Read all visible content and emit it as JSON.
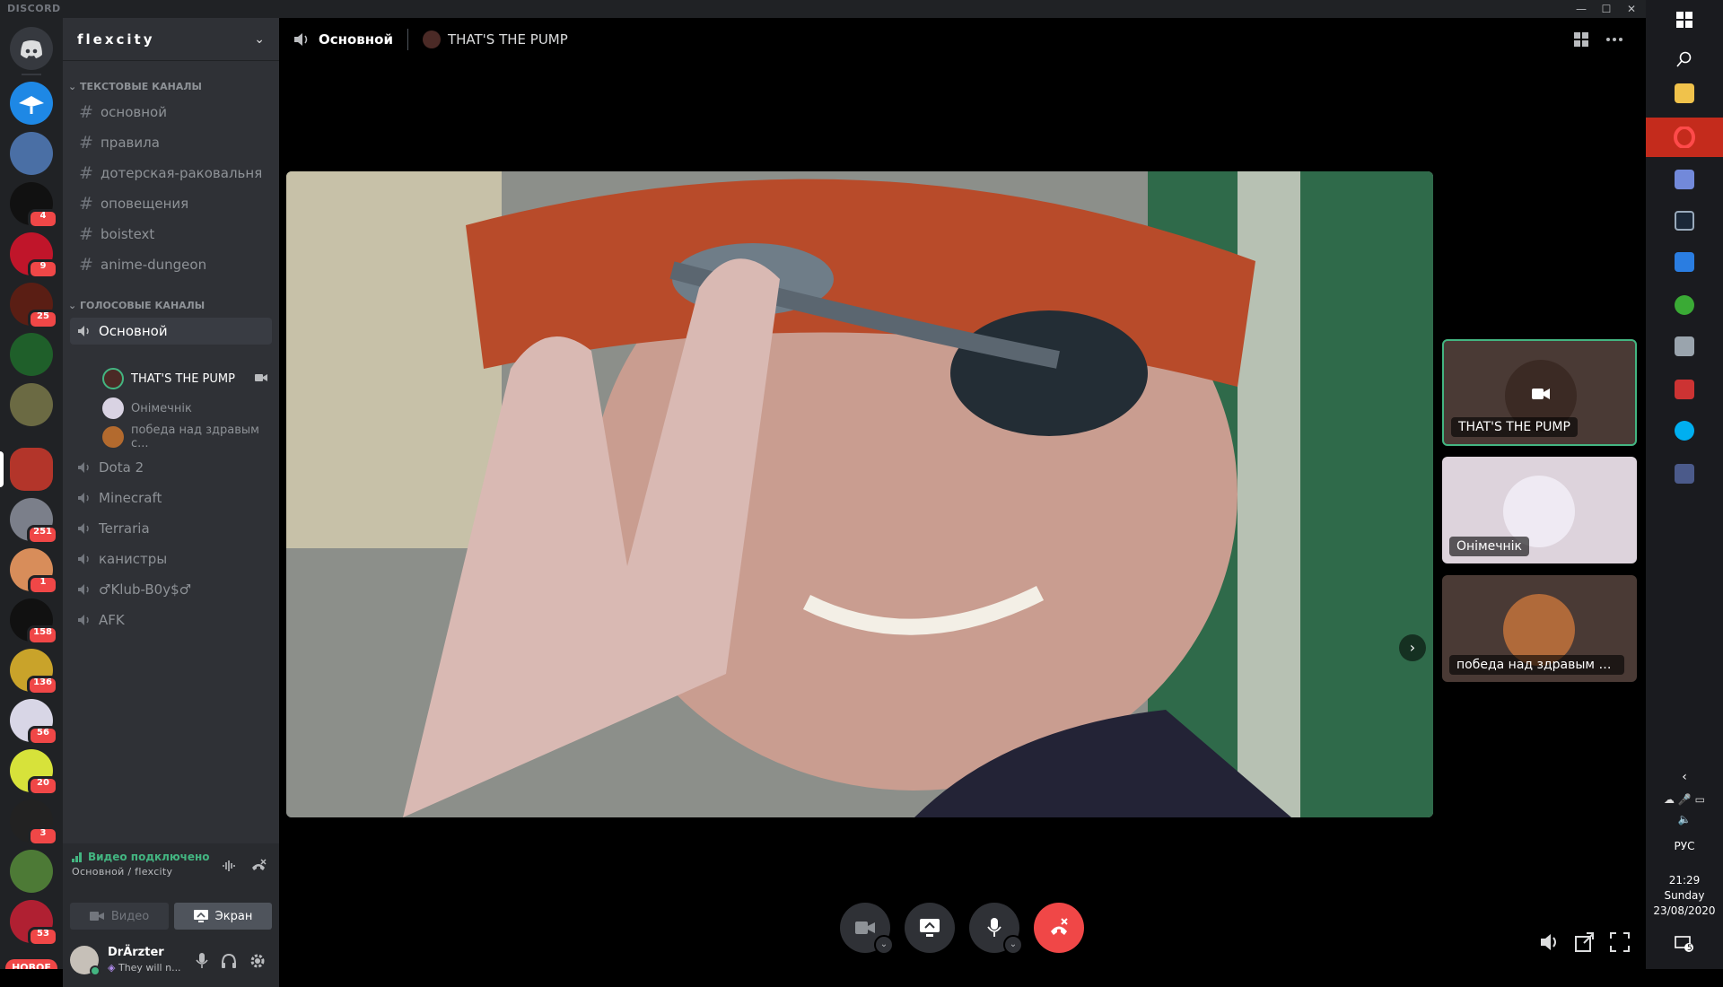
{
  "window": {
    "brand": "DISCORD",
    "minimize_glyph": "—",
    "maximize_glyph": "☐",
    "close_glyph": "✕"
  },
  "servers": {
    "new_label": "НОВОЕ",
    "badges": [
      "4",
      "9",
      "25",
      "251",
      "1",
      "158",
      "136",
      "56",
      "20",
      "3",
      "53"
    ]
  },
  "guild": {
    "name": "flexcity"
  },
  "text_category": "ТЕКСТОВЫЕ КАНАЛЫ",
  "text_channels": [
    "основной",
    "правила",
    "дотерская-раковальня",
    "оповещения",
    "boistext",
    "anime-dungeon"
  ],
  "voice_category": "ГОЛОСОВЫЕ КАНАЛЫ",
  "voice_channels": {
    "active": "Основной",
    "members": [
      "THAT'S THE PUMP",
      "Онімечнік",
      "победа над здравым с..."
    ],
    "others": [
      "Dota 2",
      "Minecraft",
      "Terraria",
      "канистры",
      "♂Klub-B0y$♂",
      "AFK"
    ]
  },
  "voice_panel": {
    "status": "Видео подключено",
    "channel": "Основной / flexcity",
    "video_button": "Видео",
    "screen_button": "Экран"
  },
  "user": {
    "name": "DrÄrzter",
    "status": "They will n..."
  },
  "header": {
    "channel": "Основной",
    "streamer": "THAT'S THE PUMP"
  },
  "tiles": [
    "THAT'S THE PUMP",
    "Онімечнік",
    "победа над здравым с..."
  ],
  "taskbar": {
    "lang": "РУС",
    "time": "21:29",
    "day": "Sunday",
    "date": "23/08/2020",
    "notifications": "5"
  },
  "colors": {
    "accent_green": "#43b581",
    "danger_red": "#f04747",
    "sidebar": "#2f3136",
    "rail": "#202225"
  },
  "icons": [
    "discord-home-icon",
    "hash-icon",
    "speaker-icon",
    "camera-icon",
    "screen-share-icon",
    "mic-icon",
    "headphones-icon",
    "gear-icon",
    "end-call-icon",
    "grid-icon",
    "more-icon",
    "volume-icon",
    "popout-icon",
    "fullscreen-icon"
  ]
}
